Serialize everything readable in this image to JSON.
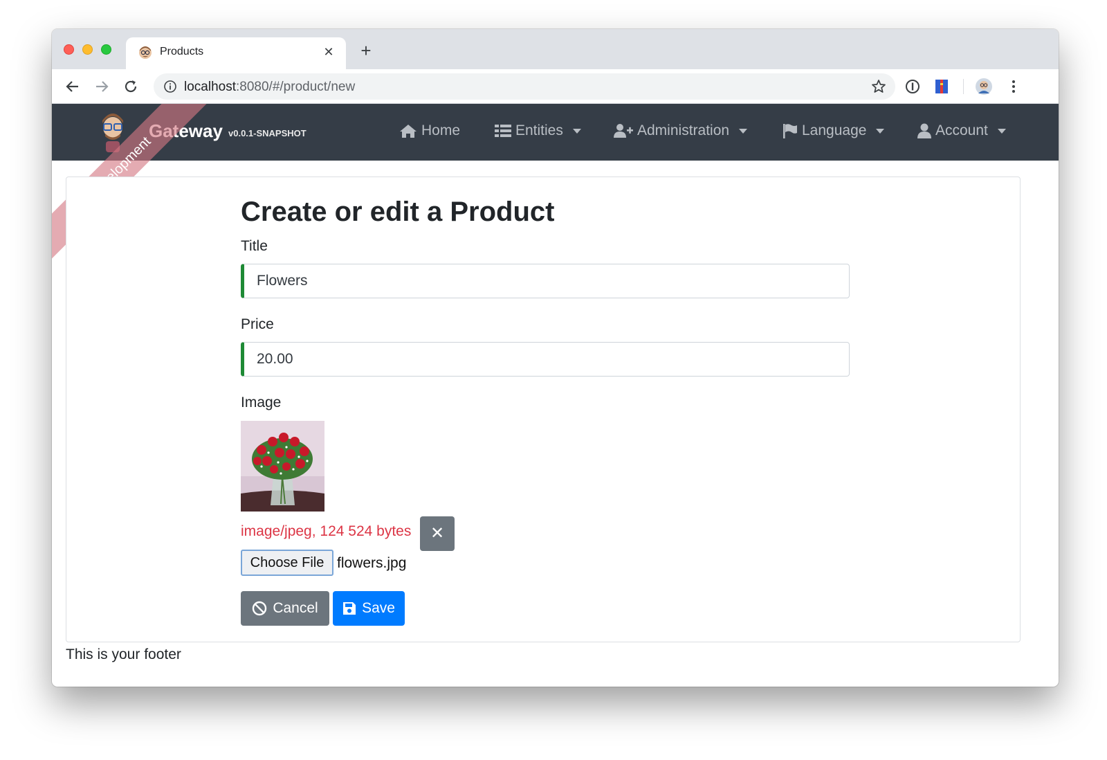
{
  "browser": {
    "tab_title": "Products",
    "tab_close": "✕",
    "new_tab": "+",
    "url_host": "localhost",
    "url_rest": ":8080/#/product/new"
  },
  "navbar": {
    "brand_title": "Gateway",
    "brand_version": "v0.0.1-SNAPSHOT",
    "ribbon": "Development",
    "items": [
      {
        "label": "Home",
        "icon": "home-icon"
      },
      {
        "label": "Entities",
        "icon": "list-icon"
      },
      {
        "label": "Administration",
        "icon": "user-plus-icon"
      },
      {
        "label": "Language",
        "icon": "flag-icon"
      },
      {
        "label": "Account",
        "icon": "user-icon"
      }
    ]
  },
  "form": {
    "heading": "Create or edit a Product",
    "title_label": "Title",
    "title_value": "Flowers",
    "price_label": "Price",
    "price_value": "20.00",
    "image_label": "Image",
    "image_meta": "image/jpeg, 124 524 bytes",
    "remove_label": "✕",
    "choose_file_label": "Choose File",
    "file_name": "flowers.jpg",
    "cancel_label": "Cancel",
    "save_label": "Save"
  },
  "footer": {
    "text": "This is your footer"
  },
  "colors": {
    "navbar_bg": "#353d47",
    "valid_border": "#1e8a35",
    "danger_text": "#dc3545",
    "primary": "#007bff",
    "secondary": "#6c757d",
    "ribbon": "#d47882"
  }
}
